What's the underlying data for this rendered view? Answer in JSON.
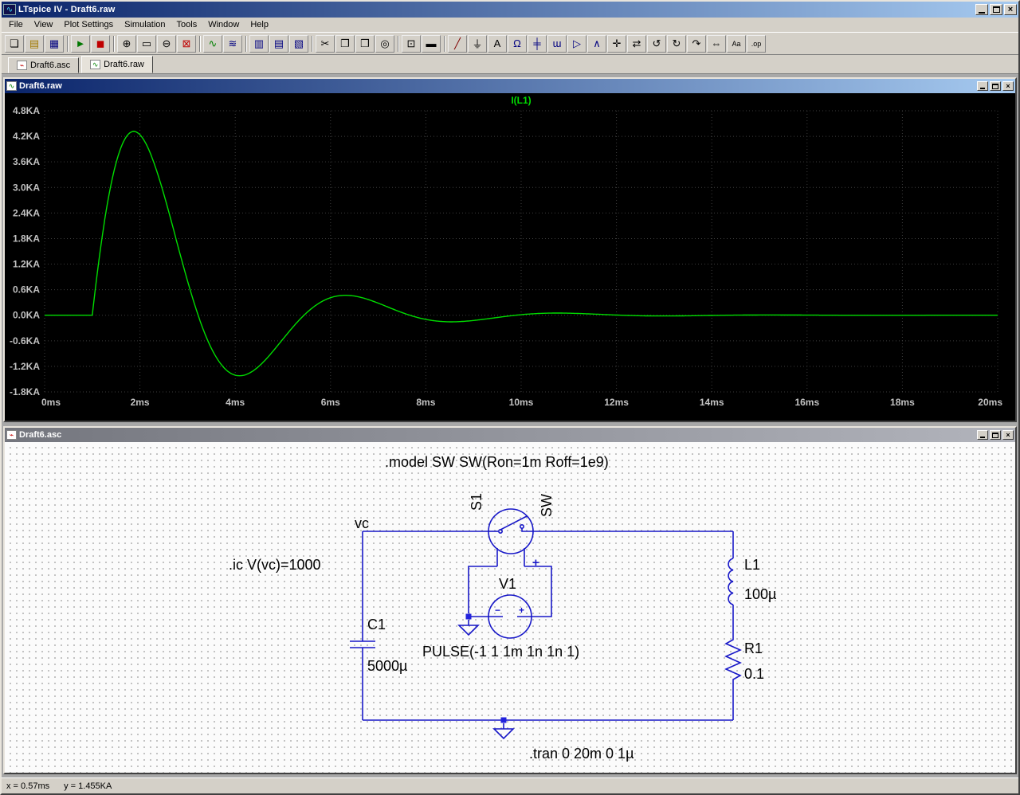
{
  "window": {
    "title": "LTspice IV - Draft6.raw"
  },
  "menu": {
    "items": [
      "File",
      "View",
      "Plot Settings",
      "Simulation",
      "Tools",
      "Window",
      "Help"
    ]
  },
  "toolbar": {
    "groups": [
      [
        {
          "name": "new-schematic",
          "glyph": "❏",
          "color": "#000000"
        },
        {
          "name": "open",
          "glyph": "▤",
          "color": "#a07800"
        },
        {
          "name": "save",
          "glyph": "▦",
          "color": "#000080"
        }
      ],
      [
        {
          "name": "run",
          "glyph": "►",
          "color": "#007700"
        },
        {
          "name": "halt",
          "glyph": "◼",
          "color": "#c00000"
        }
      ],
      [
        {
          "name": "zoom-in",
          "glyph": "⊕",
          "color": "#000000"
        },
        {
          "name": "zoom-area",
          "glyph": "▭",
          "color": "#000000"
        },
        {
          "name": "zoom-out",
          "glyph": "⊖",
          "color": "#000000"
        },
        {
          "name": "zoom-full-extents",
          "glyph": "⊠",
          "color": "#c00000"
        }
      ],
      [
        {
          "name": "plot-pane",
          "glyph": "∿",
          "color": "#008000"
        },
        {
          "name": "plot-settings",
          "glyph": "≋",
          "color": "#000080"
        }
      ],
      [
        {
          "name": "tile-vertical",
          "glyph": "▥",
          "color": "#000080"
        },
        {
          "name": "tile-horizontal",
          "glyph": "▤",
          "color": "#000080"
        },
        {
          "name": "cascade-windows",
          "glyph": "▧",
          "color": "#000080"
        }
      ],
      [
        {
          "name": "cut",
          "glyph": "✂",
          "color": "#000000"
        },
        {
          "name": "copy",
          "glyph": "❐",
          "color": "#000000"
        },
        {
          "name": "paste",
          "glyph": "❒",
          "color": "#000000"
        },
        {
          "name": "find",
          "glyph": "◎",
          "color": "#000000"
        }
      ],
      [
        {
          "name": "print-preview",
          "glyph": "⊡",
          "color": "#000000"
        },
        {
          "name": "print",
          "glyph": "▬",
          "color": "#000000"
        }
      ],
      [
        {
          "name": "wire",
          "glyph": "╱",
          "color": "#800000"
        },
        {
          "name": "ground",
          "glyph": "⏚",
          "color": "#000000"
        },
        {
          "name": "net-label",
          "glyph": "A",
          "color": "#000000"
        },
        {
          "name": "resistor",
          "glyph": "Ω",
          "color": "#000080"
        },
        {
          "name": "capacitor",
          "glyph": "╪",
          "color": "#000080"
        },
        {
          "name": "inductor",
          "glyph": "ɯ",
          "color": "#000080"
        },
        {
          "name": "diode",
          "glyph": "▷",
          "color": "#000080"
        },
        {
          "name": "component",
          "glyph": "∧",
          "color": "#000080"
        },
        {
          "name": "move",
          "glyph": "✛",
          "color": "#000000"
        },
        {
          "name": "drag",
          "glyph": "⇄",
          "color": "#000000"
        },
        {
          "name": "undo",
          "glyph": "↺",
          "color": "#000000"
        },
        {
          "name": "redo",
          "glyph": "↻",
          "color": "#000000"
        },
        {
          "name": "rotate",
          "glyph": "↷",
          "color": "#000000"
        },
        {
          "name": "mirror",
          "glyph": "⇔",
          "color": "#000000"
        },
        {
          "name": "text",
          "glyph": "Aa",
          "color": "#000000"
        },
        {
          "name": "spice-directive",
          "glyph": ".op",
          "color": "#000000"
        }
      ]
    ]
  },
  "tabs": [
    {
      "label": "Draft6.asc",
      "icon_glyph": "⌁",
      "icon_color": "#c00000",
      "active": false
    },
    {
      "label": "Draft6.raw",
      "icon_glyph": "∿",
      "icon_color": "#008000",
      "active": true
    }
  ],
  "plot_window": {
    "title": "Draft6.raw"
  },
  "chart_data": {
    "type": "line",
    "title": "I(L1)",
    "background": "#000000",
    "grid": true,
    "xlim": [
      0,
      20
    ],
    "ylim": [
      -1.8,
      4.8
    ],
    "x_ticks": [
      "0ms",
      "2ms",
      "4ms",
      "6ms",
      "8ms",
      "10ms",
      "12ms",
      "14ms",
      "16ms",
      "18ms",
      "20ms"
    ],
    "y_ticks": [
      "4.8KA",
      "4.2KA",
      "3.6KA",
      "3.0KA",
      "2.4KA",
      "1.8KA",
      "1.2KA",
      "0.6KA",
      "0.0KA",
      "-0.6KA",
      "-1.2KA",
      "-1.8KA"
    ],
    "x_unit": "ms",
    "y_unit": "KA",
    "series": [
      {
        "name": "I(L1)",
        "color": "#00dd00",
        "model": {
          "type": "damped_sine",
          "delay_ms": 1,
          "amplitude_kA": 7.071,
          "alpha_per_ms": 0.5,
          "omega_rad_per_ms": 1.41421
        },
        "points_t_ms_vs_I_kA": [
          [
            0,
            0
          ],
          [
            0.5,
            0
          ],
          [
            1,
            0
          ],
          [
            1.5,
            3.58
          ],
          [
            2,
            4.24
          ],
          [
            2.5,
            2.85
          ],
          [
            3,
            0.8
          ],
          [
            3.5,
            -0.78
          ],
          [
            4,
            -1.41
          ],
          [
            4.5,
            -1.19
          ],
          [
            5,
            -0.56
          ],
          [
            5.5,
            0.06
          ],
          [
            6,
            0.41
          ],
          [
            6.5,
            0.45
          ],
          [
            7,
            0.28
          ],
          [
            7.5,
            0.06
          ],
          [
            8,
            -0.1
          ],
          [
            8.5,
            -0.15
          ],
          [
            9,
            -0.12
          ],
          [
            9.5,
            -0.05
          ],
          [
            10,
            0.01
          ],
          [
            10.5,
            0.05
          ],
          [
            11,
            0.05
          ],
          [
            11.5,
            0.03
          ],
          [
            12,
            0.0
          ],
          [
            12.5,
            -0.01
          ],
          [
            13,
            -0.02
          ],
          [
            13.5,
            -0.01
          ],
          [
            14,
            0.0
          ],
          [
            15,
            0.0
          ],
          [
            16,
            0.0
          ],
          [
            17,
            0.0
          ],
          [
            18,
            0.0
          ],
          [
            19,
            0.0
          ],
          [
            20,
            0.0
          ]
        ]
      }
    ]
  },
  "schematic": {
    "title": "Draft6.asc",
    "model_directive": ".model SW SW(Ron=1m Roff=1e9)",
    "ic_directive": ".ic V(vc)=1000",
    "tran_directive": ".tran 0 20m 0 1µ",
    "net_label_vc": "vc",
    "s1_ref": "S1",
    "s1_value": "SW",
    "v1_ref": "V1",
    "v1_value": "PULSE(-1 1 1m 1n 1n 1)",
    "c1_ref": "C1",
    "c1_value": "5000µ",
    "l1_ref": "L1",
    "l1_value": "100µ",
    "r1_ref": "R1",
    "r1_value": "0.1",
    "switch_plus": "+",
    "v1_plus": "+",
    "v1_minus": "−"
  },
  "status_bar": {
    "x_readout": "x = 0.57ms",
    "y_readout": "y = 1.455KA"
  }
}
